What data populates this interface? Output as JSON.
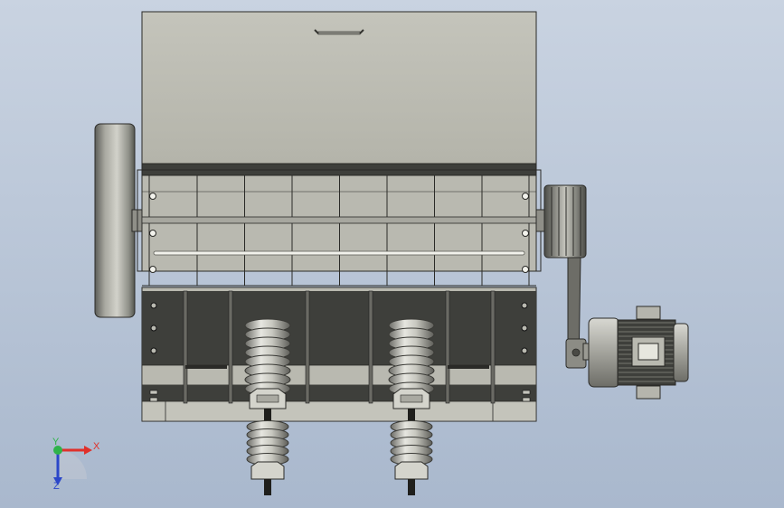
{
  "viewport": {
    "background_top": "#c9d3e1",
    "background_bottom": "#a9b8cd"
  },
  "triad": {
    "x_label": "X",
    "y_label": "Y",
    "z_label": "Z",
    "x_color": "#e0302a",
    "y_color": "#2fb34a",
    "z_color": "#2b47c9"
  },
  "model": {
    "body_color": "#b9b9b0",
    "dark_color": "#3e3f3b",
    "spring_count": 2,
    "grid_columns": 8
  }
}
